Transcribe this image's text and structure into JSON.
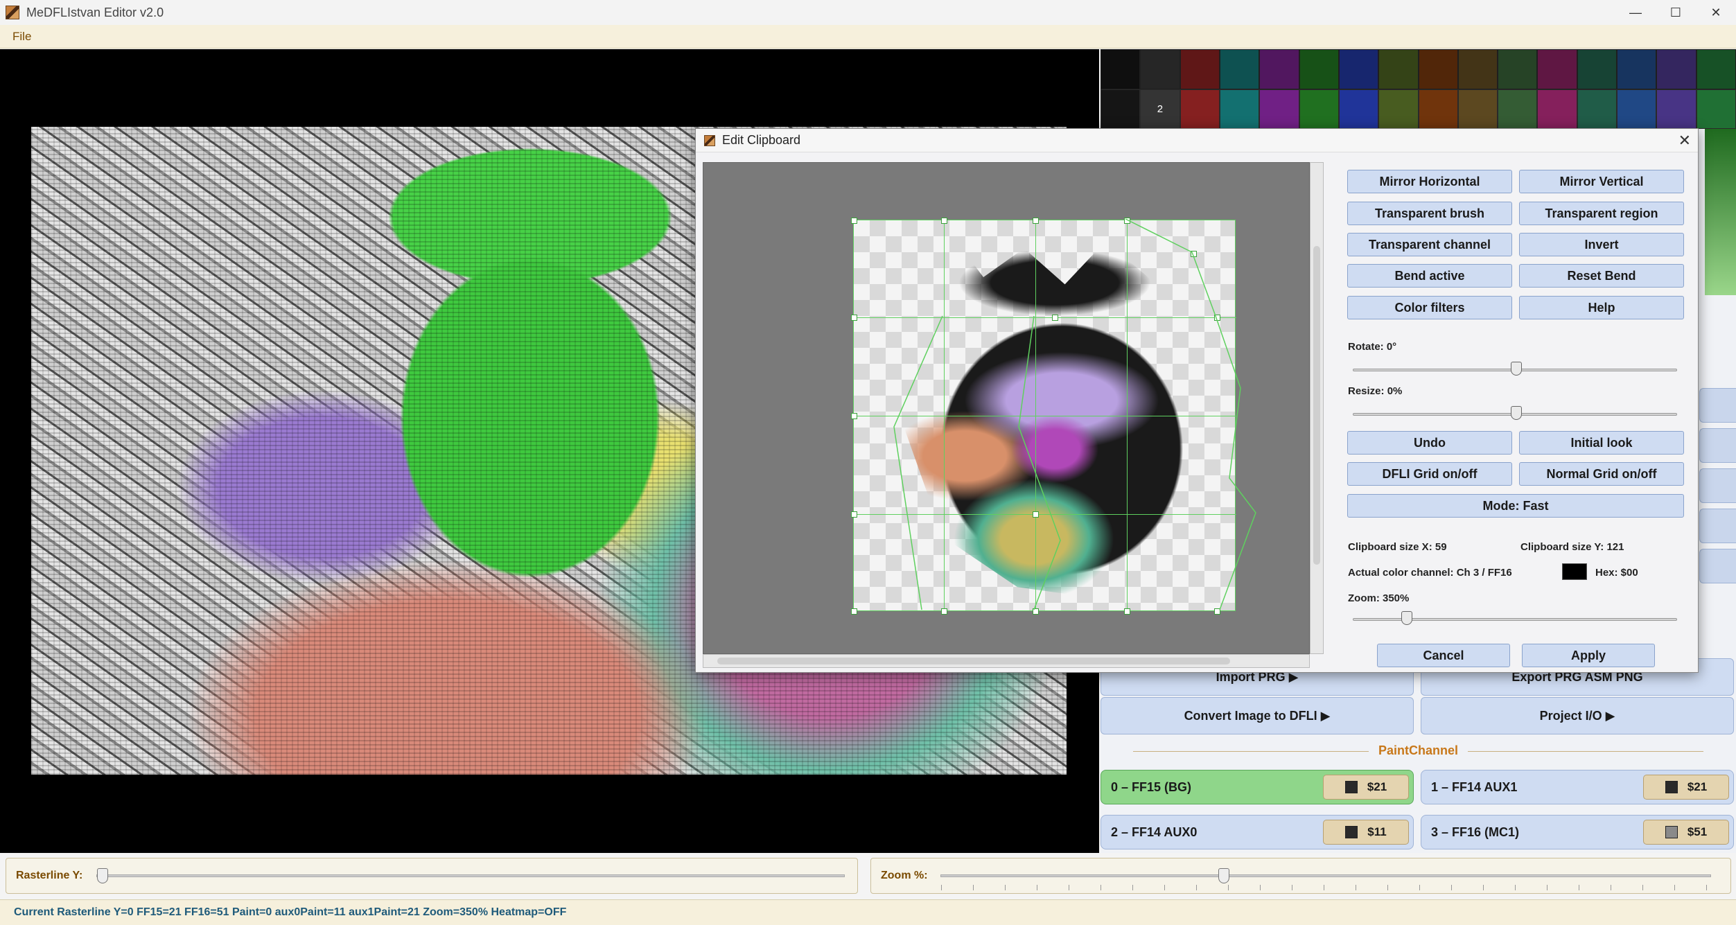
{
  "window": {
    "title": "MeDFLIstvan Editor v2.0",
    "minimize": "—",
    "maximize": "☐",
    "close": "✕"
  },
  "menu": {
    "file": "File"
  },
  "palette": {
    "rows": [
      [
        "",
        "",
        "",
        "",
        "",
        "",
        "",
        "",
        "",
        "",
        "",
        "",
        "",
        "",
        "",
        ""
      ],
      [
        "",
        "2",
        "",
        "",
        "",
        "",
        "",
        "",
        "",
        "",
        "",
        "",
        "",
        "",
        "",
        ""
      ]
    ],
    "colors": [
      "#111",
      "#2a2a2a",
      "#6a1a1a",
      "#0f5a5a",
      "#5a1a6a",
      "#1a5a1a",
      "#1a2a7a",
      "#3a4a1a",
      "#5a2a0a",
      "#4a3a1a",
      "#2a4a2a",
      "#6a1a4a",
      "#1a4a3a",
      "#1a3a6a",
      "#3a2a6a",
      "#1a5a2a"
    ]
  },
  "right_panel": {
    "import_prg": "Import PRG ▶",
    "export": "Export PRG ASM PNG",
    "convert": "Convert Image to DFLI ▶",
    "project_io": "Project I/O ▶",
    "paint_title": "PaintChannel",
    "channels": [
      {
        "label": "0 – FF15 (BG)",
        "hex": "$21",
        "color": "#2a2a2a"
      },
      {
        "label": "1 – FF14 AUX1",
        "hex": "$21",
        "color": "#2a2a2a"
      },
      {
        "label": "2 – FF14 AUX0",
        "hex": "$11",
        "color": "#2a2a2a"
      },
      {
        "label": "3 – FF16 (MC1)",
        "hex": "$51",
        "color": "#8a8a8a"
      }
    ]
  },
  "bottom": {
    "raster_label": "Rasterline Y:",
    "zoom_label": "Zoom %:",
    "status": "Current Rasterline Y=0  FF15=21  FF16=51  Paint=0  aux0Paint=11  aux1Paint=21  Zoom=350%  Heatmap=OFF"
  },
  "dialog": {
    "title": "Edit Clipboard",
    "close": "✕",
    "buttons": {
      "mirror_h": "Mirror Horizontal",
      "mirror_v": "Mirror Vertical",
      "transparent_brush": "Transparent brush",
      "transparent_region": "Transparent region",
      "transparent_channel": "Transparent channel",
      "invert": "Invert",
      "bend_active": "Bend active",
      "reset_bend": "Reset Bend",
      "color_filters": "Color filters",
      "help": "Help",
      "undo": "Undo",
      "initial_look": "Initial look",
      "dfli_grid": "DFLI Grid on/off",
      "normal_grid": "Normal Grid on/off",
      "mode": "Mode: Fast",
      "cancel": "Cancel",
      "apply": "Apply"
    },
    "rotate_label": "Rotate: 0°",
    "resize_label": "Resize: 0%",
    "clip_size_x": "Clipboard size X: 59",
    "clip_size_y": "Clipboard size Y: 121",
    "channel_text": "Actual color channel: Ch 3 / FF16",
    "hex_text": "Hex: $00",
    "hex_color": "#000000",
    "zoom_label": "Zoom: 350%",
    "rotate_value": 0,
    "resize_value": 0,
    "zoom_value": 350
  }
}
